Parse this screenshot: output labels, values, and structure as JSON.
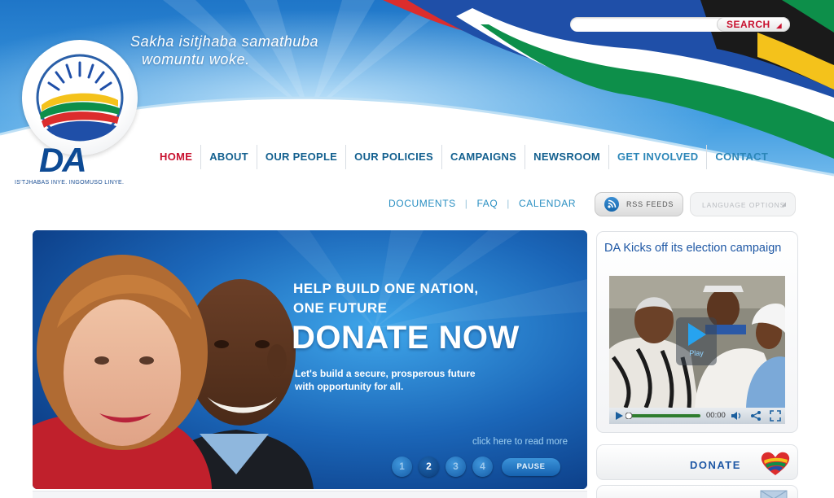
{
  "header": {
    "slogan_line1": "Sakha isitjhaba samathuba",
    "slogan_line2": "womuntu woke.",
    "logo_text": "DA",
    "logo_tagline": "IS'TJHABAS INYE.  INGOMUSO LINYE.",
    "search": {
      "placeholder": "",
      "button_label": "SEARCH"
    }
  },
  "main_nav": {
    "items": [
      {
        "label": "HOME",
        "state": "active"
      },
      {
        "label": "ABOUT"
      },
      {
        "label": "OUR PEOPLE"
      },
      {
        "label": "OUR POLICIES"
      },
      {
        "label": "CAMPAIGNS"
      },
      {
        "label": "NEWSROOM"
      },
      {
        "label": "GET INVOLVED"
      },
      {
        "label": "CONTACT"
      }
    ]
  },
  "secondary_nav": {
    "items": [
      "DOCUMENTS",
      "FAQ",
      "CALENDAR"
    ],
    "separator": "|",
    "rss_label": "RSS FEEDS",
    "language_label": "LANGUAGE OPTIONS"
  },
  "banner": {
    "headline_line1": "HELP BUILD ONE NATION,",
    "headline_line2": "ONE FUTURE",
    "cta": "DONATE NOW",
    "subtext_line1": "Let's build a secure, prosperous future",
    "subtext_line2": "with opportunity for all.",
    "read_more": "click here to read more",
    "pages": [
      "1",
      "2",
      "3",
      "4"
    ],
    "current_page": "2",
    "pause_label": "PAUSE"
  },
  "video": {
    "title": "DA Kicks off its election campaign",
    "play_label": "Play",
    "time": "00:00"
  },
  "side": {
    "donate_label": "DONATE"
  },
  "colors": {
    "brand_blue": "#1f58a5",
    "nav_blue": "#13608f",
    "active_red": "#c8102e",
    "link_blue": "#2a8fc2"
  },
  "icons": [
    "rss-icon",
    "play-icon",
    "volume-icon",
    "share-icon",
    "fullscreen-icon",
    "heart-icon",
    "mail-icon"
  ]
}
